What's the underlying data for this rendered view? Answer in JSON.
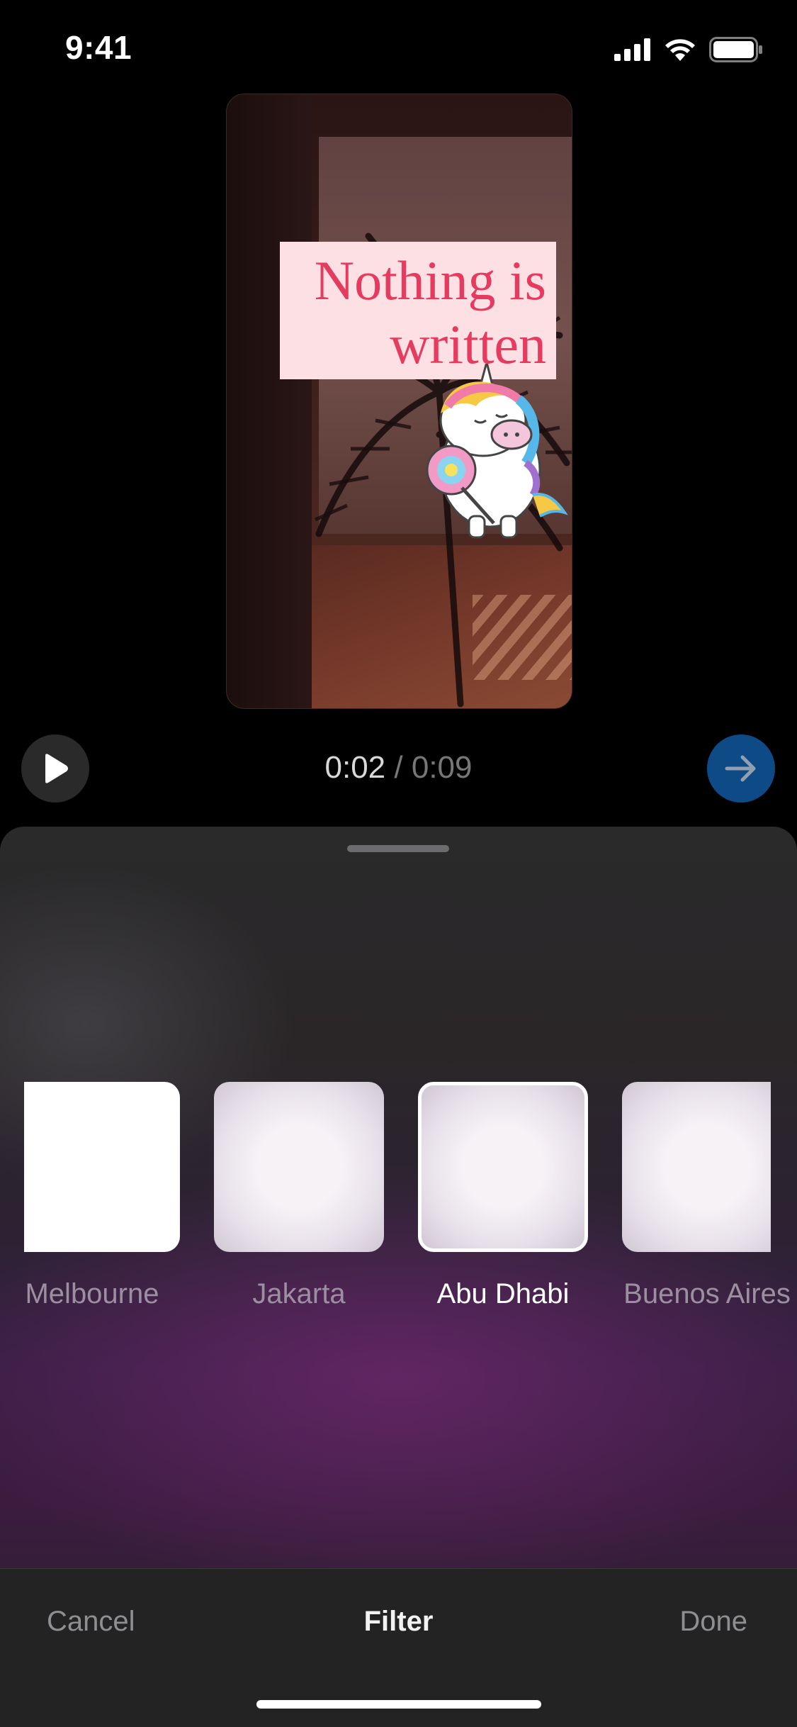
{
  "status_bar": {
    "time": "9:41",
    "icons": [
      "cellular-signal-icon",
      "wifi-icon",
      "battery-icon"
    ]
  },
  "preview": {
    "caption": "Nothing is written",
    "caption_color": "#e63a5e",
    "caption_background": "#fde0e4",
    "sticker": "unicorn-sticker"
  },
  "playback": {
    "current_time": "0:02",
    "separator": " / ",
    "total_time": "0:09",
    "play_icon": "play-icon",
    "next_icon": "arrow-right-icon",
    "accent_color": "#0d4a86"
  },
  "filters": {
    "items": [
      {
        "label": "Melbourne",
        "selected": false
      },
      {
        "label": "Jakarta",
        "selected": false
      },
      {
        "label": "Abu Dhabi",
        "selected": true
      },
      {
        "label": "Buenos Aires",
        "selected": false
      }
    ]
  },
  "bottom_bar": {
    "cancel_label": "Cancel",
    "title": "Filter",
    "done_label": "Done"
  }
}
